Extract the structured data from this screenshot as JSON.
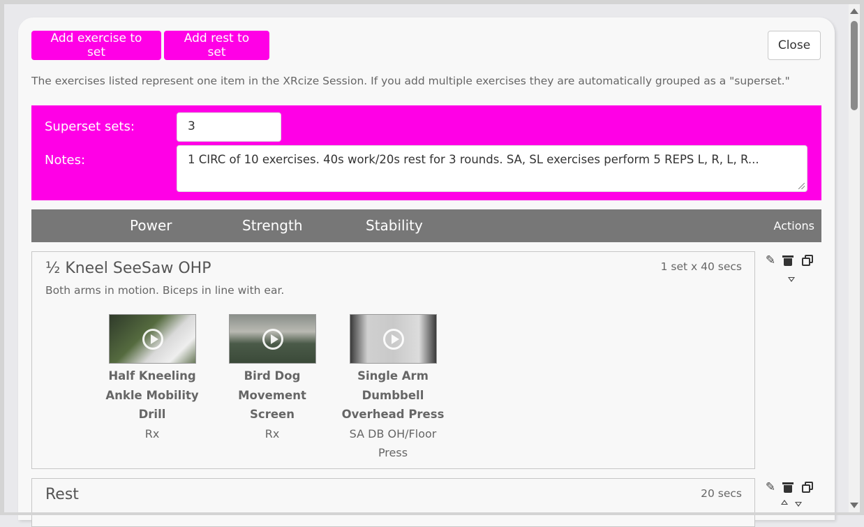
{
  "toolbar": {
    "add_exercise_label": "Add exercise to set",
    "add_rest_label": "Add rest to set",
    "close_label": "Close"
  },
  "intro_text": "The exercises listed represent one item in the XRcize Session. If you add multiple exercises they are automatically grouped as a \"superset.\"",
  "superset": {
    "sets_label": "Superset sets:",
    "sets_value": "3",
    "notes_label": "Notes:",
    "notes_value": "1 CIRC of 10 exercises. 40s work/20s rest for 3 rounds. SA, SL exercises perform 5 REPS L, R, L, R..."
  },
  "tabs": {
    "power": "Power",
    "strength": "Strength",
    "stability": "Stability",
    "actions": "Actions"
  },
  "items": [
    {
      "title": "½ Kneel SeeSaw OHP",
      "meta": "1 set x 40 secs",
      "description": "Both arms in motion. Biceps in line with ear.",
      "exercises": [
        {
          "name": "Half Kneeling Ankle Mobility Drill",
          "sub": "Rx"
        },
        {
          "name": "Bird Dog Movement Screen",
          "sub": "Rx"
        },
        {
          "name": "Single Arm Dumbbell Overhead Press",
          "sub": "SA DB OH/Floor Press"
        }
      ]
    },
    {
      "title": "Rest",
      "meta": "20 secs"
    }
  ],
  "icons": {
    "edit": "pencil-icon",
    "delete": "trash-icon",
    "duplicate": "copy-icon",
    "move_down": "triangle-down-icon",
    "move_up": "triangle-up-icon",
    "play": "play-icon"
  },
  "colors": {
    "accent": "#ff00e6",
    "tab_bar": "#777777"
  }
}
